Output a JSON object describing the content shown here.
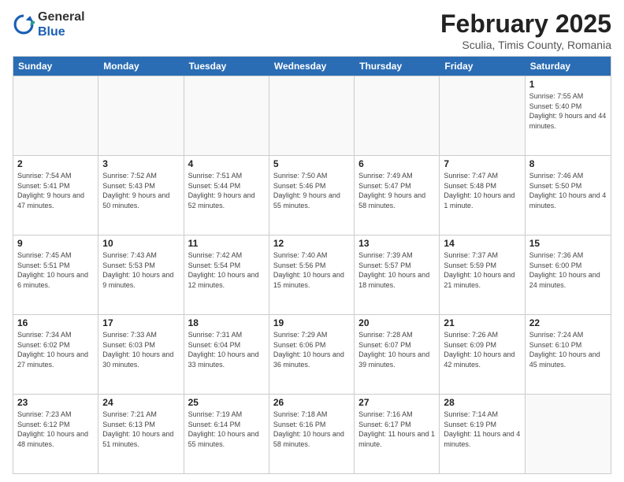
{
  "logo": {
    "general": "General",
    "blue": "Blue"
  },
  "header": {
    "title": "February 2025",
    "subtitle": "Sculia, Timis County, Romania"
  },
  "days": [
    "Sunday",
    "Monday",
    "Tuesday",
    "Wednesday",
    "Thursday",
    "Friday",
    "Saturday"
  ],
  "weeks": [
    [
      {
        "day": "",
        "info": ""
      },
      {
        "day": "",
        "info": ""
      },
      {
        "day": "",
        "info": ""
      },
      {
        "day": "",
        "info": ""
      },
      {
        "day": "",
        "info": ""
      },
      {
        "day": "",
        "info": ""
      },
      {
        "day": "1",
        "info": "Sunrise: 7:55 AM\nSunset: 5:40 PM\nDaylight: 9 hours and 44 minutes."
      }
    ],
    [
      {
        "day": "2",
        "info": "Sunrise: 7:54 AM\nSunset: 5:41 PM\nDaylight: 9 hours and 47 minutes."
      },
      {
        "day": "3",
        "info": "Sunrise: 7:52 AM\nSunset: 5:43 PM\nDaylight: 9 hours and 50 minutes."
      },
      {
        "day": "4",
        "info": "Sunrise: 7:51 AM\nSunset: 5:44 PM\nDaylight: 9 hours and 52 minutes."
      },
      {
        "day": "5",
        "info": "Sunrise: 7:50 AM\nSunset: 5:46 PM\nDaylight: 9 hours and 55 minutes."
      },
      {
        "day": "6",
        "info": "Sunrise: 7:49 AM\nSunset: 5:47 PM\nDaylight: 9 hours and 58 minutes."
      },
      {
        "day": "7",
        "info": "Sunrise: 7:47 AM\nSunset: 5:48 PM\nDaylight: 10 hours and 1 minute."
      },
      {
        "day": "8",
        "info": "Sunrise: 7:46 AM\nSunset: 5:50 PM\nDaylight: 10 hours and 4 minutes."
      }
    ],
    [
      {
        "day": "9",
        "info": "Sunrise: 7:45 AM\nSunset: 5:51 PM\nDaylight: 10 hours and 6 minutes."
      },
      {
        "day": "10",
        "info": "Sunrise: 7:43 AM\nSunset: 5:53 PM\nDaylight: 10 hours and 9 minutes."
      },
      {
        "day": "11",
        "info": "Sunrise: 7:42 AM\nSunset: 5:54 PM\nDaylight: 10 hours and 12 minutes."
      },
      {
        "day": "12",
        "info": "Sunrise: 7:40 AM\nSunset: 5:56 PM\nDaylight: 10 hours and 15 minutes."
      },
      {
        "day": "13",
        "info": "Sunrise: 7:39 AM\nSunset: 5:57 PM\nDaylight: 10 hours and 18 minutes."
      },
      {
        "day": "14",
        "info": "Sunrise: 7:37 AM\nSunset: 5:59 PM\nDaylight: 10 hours and 21 minutes."
      },
      {
        "day": "15",
        "info": "Sunrise: 7:36 AM\nSunset: 6:00 PM\nDaylight: 10 hours and 24 minutes."
      }
    ],
    [
      {
        "day": "16",
        "info": "Sunrise: 7:34 AM\nSunset: 6:02 PM\nDaylight: 10 hours and 27 minutes."
      },
      {
        "day": "17",
        "info": "Sunrise: 7:33 AM\nSunset: 6:03 PM\nDaylight: 10 hours and 30 minutes."
      },
      {
        "day": "18",
        "info": "Sunrise: 7:31 AM\nSunset: 6:04 PM\nDaylight: 10 hours and 33 minutes."
      },
      {
        "day": "19",
        "info": "Sunrise: 7:29 AM\nSunset: 6:06 PM\nDaylight: 10 hours and 36 minutes."
      },
      {
        "day": "20",
        "info": "Sunrise: 7:28 AM\nSunset: 6:07 PM\nDaylight: 10 hours and 39 minutes."
      },
      {
        "day": "21",
        "info": "Sunrise: 7:26 AM\nSunset: 6:09 PM\nDaylight: 10 hours and 42 minutes."
      },
      {
        "day": "22",
        "info": "Sunrise: 7:24 AM\nSunset: 6:10 PM\nDaylight: 10 hours and 45 minutes."
      }
    ],
    [
      {
        "day": "23",
        "info": "Sunrise: 7:23 AM\nSunset: 6:12 PM\nDaylight: 10 hours and 48 minutes."
      },
      {
        "day": "24",
        "info": "Sunrise: 7:21 AM\nSunset: 6:13 PM\nDaylight: 10 hours and 51 minutes."
      },
      {
        "day": "25",
        "info": "Sunrise: 7:19 AM\nSunset: 6:14 PM\nDaylight: 10 hours and 55 minutes."
      },
      {
        "day": "26",
        "info": "Sunrise: 7:18 AM\nSunset: 6:16 PM\nDaylight: 10 hours and 58 minutes."
      },
      {
        "day": "27",
        "info": "Sunrise: 7:16 AM\nSunset: 6:17 PM\nDaylight: 11 hours and 1 minute."
      },
      {
        "day": "28",
        "info": "Sunrise: 7:14 AM\nSunset: 6:19 PM\nDaylight: 11 hours and 4 minutes."
      },
      {
        "day": "",
        "info": ""
      }
    ]
  ]
}
